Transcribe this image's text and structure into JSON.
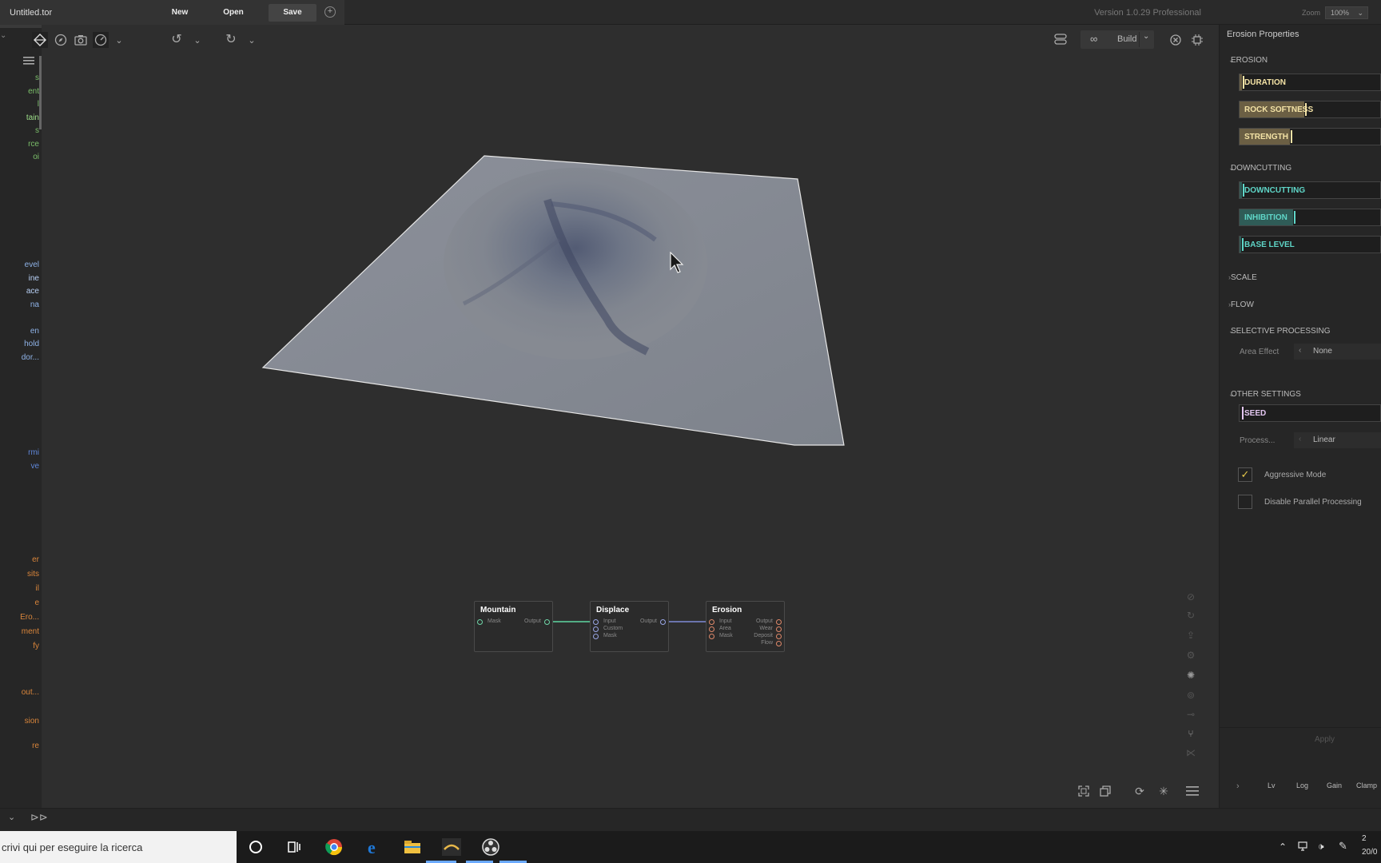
{
  "app": {
    "document_tab": "Untitled.tor",
    "file_buttons": {
      "new": "New",
      "open": "Open",
      "save": "Save"
    },
    "version": "Version 1.0.29 Professional",
    "zoom_label": "Zoom",
    "zoom_value": "100%"
  },
  "sidebar": {
    "items_green": [
      "s",
      "ent",
      "l",
      "tain",
      "s",
      "rce",
      "oi"
    ],
    "items_blue": [
      "evel",
      "ine",
      "ace",
      "na",
      "",
      "en",
      "hold",
      "dor..."
    ],
    "items_blue2": [
      "rmi",
      "ve"
    ],
    "items_orange": [
      "er",
      "sits",
      "il",
      "e",
      "Ero...",
      "ment",
      "fy",
      "out...",
      "sion",
      "re"
    ]
  },
  "toolbar": {
    "build_label": "Build"
  },
  "nodes": [
    {
      "title": "Mountain",
      "inputs": [
        "Mask"
      ],
      "outputs": [
        "Output"
      ]
    },
    {
      "title": "Displace",
      "inputs": [
        "Input",
        "Custom",
        "Mask"
      ],
      "outputs": [
        "Output"
      ]
    },
    {
      "title": "Erosion",
      "inputs": [
        "Input",
        "Area",
        "Mask"
      ],
      "outputs": [
        "Output",
        "Wear",
        "Deposit",
        "Flow"
      ]
    }
  ],
  "properties": {
    "title": "Erosion Properties",
    "sections": {
      "erosion": "EROSION",
      "downcutting": "DOWNCUTTING",
      "scale": "SCALE",
      "flow": "FLOW",
      "selective": "SELECTIVE PROCESSING",
      "other": "OTHER SETTINGS"
    },
    "erosion_sliders": [
      {
        "label": "DURATION",
        "value": 0.02
      },
      {
        "label": "ROCK SOFTNESS",
        "value": 0.63
      },
      {
        "label": "STRENGTH",
        "value": 0.49
      }
    ],
    "downcutting_sliders": [
      {
        "label": "DOWNCUTTING",
        "value": 0.02
      },
      {
        "label": "INHIBITION",
        "value": 0.52
      },
      {
        "label": "BASE LEVEL",
        "value": 0.0
      }
    ],
    "area_effect_label": "Area Effect",
    "area_effect_value": "None",
    "seed_label": "SEED",
    "process_label": "Process...",
    "process_value": "Linear",
    "aggressive_mode_label": "Aggressive Mode",
    "aggressive_mode_checked": true,
    "disable_parallel_label": "Disable Parallel Processing",
    "disable_parallel_checked": false,
    "apply_label": "Apply",
    "bottom_buttons": [
      "Lv",
      "Log",
      "Gain",
      "Clamp"
    ]
  },
  "taskbar": {
    "search_placeholder": "crivi qui per eseguire la ricerca",
    "clock_time": "2",
    "clock_date": "20/0"
  },
  "colors": {
    "erosion_accent": "#f3e2a5",
    "erosion_fill": "#6b5f44",
    "downcutting_accent": "#5fd6c8",
    "downcutting_fill": "#2f5c57",
    "seed_accent": "#e3c6f0"
  }
}
